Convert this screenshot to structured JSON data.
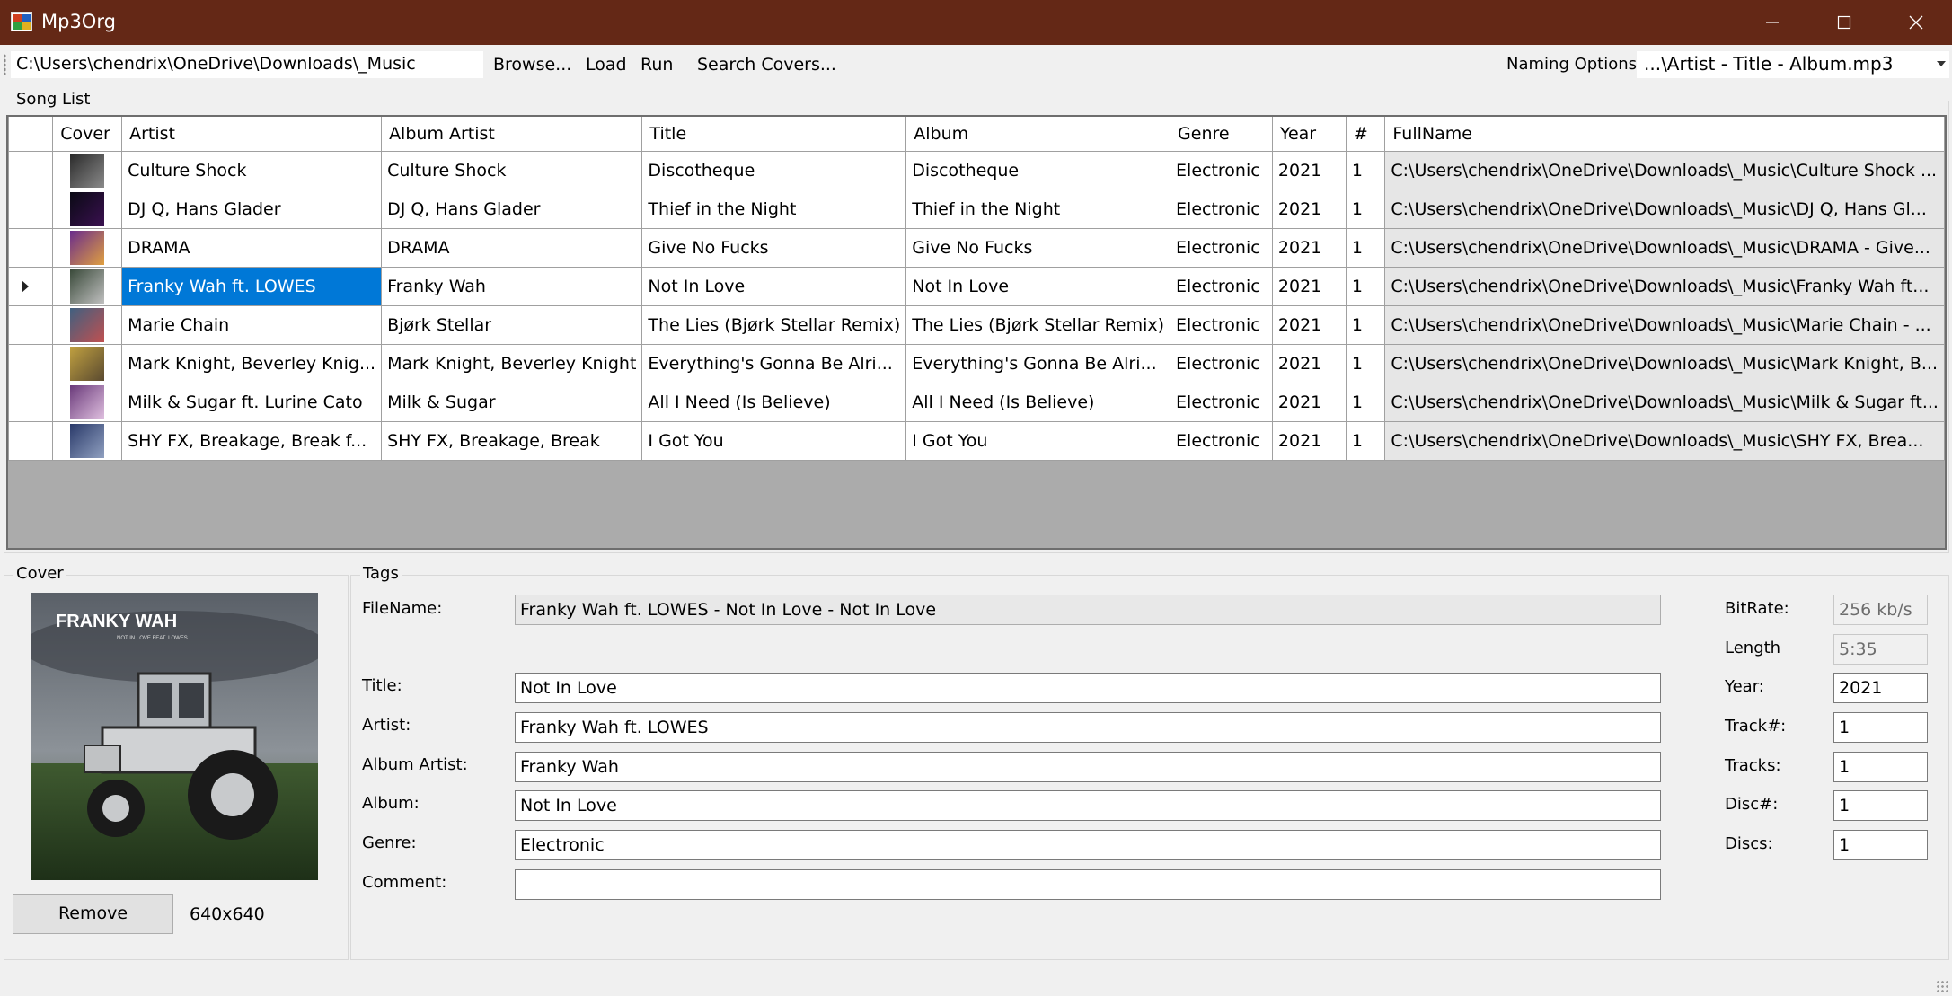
{
  "window": {
    "title": "Mp3Org"
  },
  "toolbar": {
    "path": "C:\\Users\\chendrix\\OneDrive\\Downloads\\_Music",
    "browse_label": "Browse...",
    "load_label": "Load",
    "run_label": "Run",
    "search_covers_label": "Search Covers...",
    "naming_label": "Naming Options:",
    "naming_value": "...\\Artist - Title - Album.mp3"
  },
  "song_list": {
    "title": "Song List",
    "columns": [
      "",
      "Cover",
      "Artist",
      "Album Artist",
      "Title",
      "Album",
      "Genre",
      "Year",
      "#",
      "FullName"
    ],
    "rows": [
      [
        "Culture Shock",
        "Culture Shock",
        "Discotheque",
        "Discotheque",
        "Electronic",
        "2021",
        "1",
        "C:\\Users\\chendrix\\OneDrive\\Downloads\\_Music\\Culture Shock ..."
      ],
      [
        "DJ Q, Hans Glader",
        "DJ Q, Hans Glader",
        "Thief in the Night",
        "Thief in the Night",
        "Electronic",
        "2021",
        "1",
        "C:\\Users\\chendrix\\OneDrive\\Downloads\\_Music\\DJ Q, Hans Gl..."
      ],
      [
        "DRAMA",
        "DRAMA",
        "Give No Fucks",
        "Give No Fucks",
        "Electronic",
        "2021",
        "1",
        "C:\\Users\\chendrix\\OneDrive\\Downloads\\_Music\\DRAMA - Give..."
      ],
      [
        "Franky Wah ft. LOWES",
        "Franky Wah",
        "Not In Love",
        "Not In Love",
        "Electronic",
        "2021",
        "1",
        "C:\\Users\\chendrix\\OneDrive\\Downloads\\_Music\\Franky Wah ft..."
      ],
      [
        "Marie Chain",
        "Bjørk Stellar",
        "The Lies (Bjørk Stellar Remix)",
        "The Lies (Bjørk Stellar Remix)",
        "Electronic",
        "2021",
        "1",
        "C:\\Users\\chendrix\\OneDrive\\Downloads\\_Music\\Marie Chain - ..."
      ],
      [
        "Mark Knight, Beverley Knig...",
        "Mark Knight, Beverley Knight",
        "Everything's Gonna Be Alri...",
        "Everything's Gonna Be Alri...",
        "Electronic",
        "2021",
        "1",
        "C:\\Users\\chendrix\\OneDrive\\Downloads\\_Music\\Mark Knight, B..."
      ],
      [
        "Milk & Sugar ft. Lurine Cato",
        "Milk & Sugar",
        "All I Need (Is Believe)",
        "All I Need (Is Believe)",
        "Electronic",
        "2021",
        "1",
        "C:\\Users\\chendrix\\OneDrive\\Downloads\\_Music\\Milk & Sugar ft..."
      ],
      [
        "SHY FX, Breakage, Break f...",
        "SHY FX, Breakage, Break",
        "I Got You",
        "I Got You",
        "Electronic",
        "2021",
        "1",
        "C:\\Users\\chendrix\\OneDrive\\Downloads\\_Music\\SHY FX, Brea..."
      ]
    ],
    "selected_row": 3,
    "thumb_colors": [
      [
        "#2a2a2a",
        "#8a8a8a"
      ],
      [
        "#0a0a14",
        "#3a1050"
      ],
      [
        "#6a2c8c",
        "#e0a040"
      ],
      [
        "#3a4a3a",
        "#c0c0c0"
      ],
      [
        "#406080",
        "#c05050"
      ],
      [
        "#c0a040",
        "#5a4a30"
      ],
      [
        "#6a3a7a",
        "#e0c0e0"
      ],
      [
        "#2a3a6a",
        "#90a0c0"
      ]
    ]
  },
  "cover": {
    "title": "Cover",
    "art_text": "FRANKY WAH",
    "art_subtext": "NOT IN LOVE FEAT. LOWES",
    "remove_label": "Remove",
    "dimensions": "640x640"
  },
  "tags": {
    "title": "Tags",
    "filename_label": "FileName:",
    "filename_value": "Franky Wah ft. LOWES - Not In Love - Not In Love",
    "title_label": "Title:",
    "title_value": "Not In Love",
    "artist_label": "Artist:",
    "artist_value": "Franky Wah ft. LOWES",
    "album_artist_label": "Album Artist:",
    "album_artist_value": "Franky Wah",
    "album_label": "Album:",
    "album_value": "Not In Love",
    "genre_label": "Genre:",
    "genre_value": "Electronic",
    "comment_label": "Comment:",
    "comment_value": "",
    "bitrate_label": "BitRate:",
    "bitrate_value": "256 kb/s",
    "length_label": "Length",
    "length_value": "5:35",
    "year_label": "Year:",
    "year_value": "2021",
    "track_label": "Track#:",
    "track_value": "1",
    "tracks_label": "Tracks:",
    "tracks_value": "1",
    "disc_label": "Disc#:",
    "disc_value": "1",
    "discs_label": "Discs:",
    "discs_value": "1"
  },
  "colors": {
    "titlebar": "#642816",
    "selection": "#0078d7",
    "grid_empty": "#ababab"
  }
}
